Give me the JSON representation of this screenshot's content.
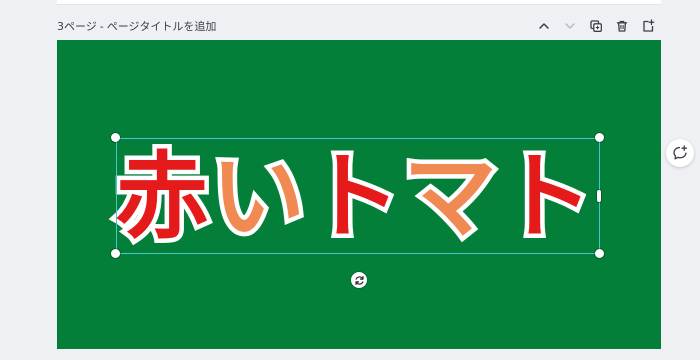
{
  "page": {
    "number_label": "3ページ",
    "separator": "-",
    "title_placeholder": "ページタイトルを追加"
  },
  "toolbar": {
    "move_up_icon": "chevron-up-icon",
    "move_down_icon": "chevron-down-icon",
    "duplicate_icon": "duplicate-icon",
    "delete_icon": "trash-icon",
    "add_page_icon": "add-page-icon"
  },
  "canvas": {
    "background_color": "#047f3a",
    "text_element": {
      "characters": [
        {
          "char": "赤",
          "color": "#e51b1b"
        },
        {
          "char": "い",
          "color": "#f08a52"
        },
        {
          "char": "ト",
          "color": "#e51b1b"
        },
        {
          "char": "マ",
          "color": "#f08a52"
        },
        {
          "char": "ト",
          "color": "#e51b1b"
        }
      ],
      "outline_color": "#ffffff"
    },
    "selection_color": "#48c6d4"
  },
  "side": {
    "comment_icon": "add-comment-icon"
  }
}
